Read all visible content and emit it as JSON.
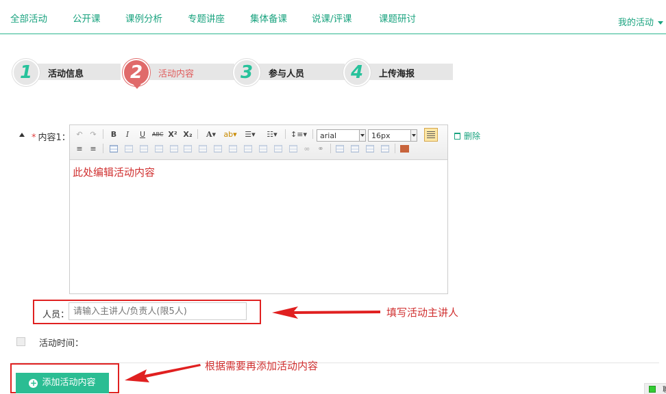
{
  "nav": {
    "items": [
      "全部活动",
      "公开课",
      "课例分析",
      "专题讲座",
      "集体备课",
      "说课/评课",
      "课题研讨"
    ],
    "my_activity": "我的活动"
  },
  "steps": [
    {
      "num": "1",
      "label": "活动信息",
      "active": false
    },
    {
      "num": "2",
      "label": "活动内容",
      "active": true
    },
    {
      "num": "3",
      "label": "参与人员",
      "active": false
    },
    {
      "num": "4",
      "label": "上传海报",
      "active": false
    }
  ],
  "content": {
    "required_mark": "*",
    "label": "内容1：",
    "delete_label": "删除",
    "editor_text": "此处编辑活动内容",
    "toolbar": {
      "font_family": "arial",
      "font_size": "16px"
    }
  },
  "person": {
    "label": "人员：",
    "placeholder": "请输入主讲人/负责人(限5人)"
  },
  "time": {
    "label": "活动时间："
  },
  "add_button": "添加活动内容",
  "annotations": {
    "person_hint": "填写活动主讲人",
    "add_hint": "根据需要再添加活动内容"
  },
  "corner_text": "聯",
  "colors": {
    "accent": "#2bbd93",
    "active_step": "#e06a6a",
    "annotation": "#d03030"
  }
}
